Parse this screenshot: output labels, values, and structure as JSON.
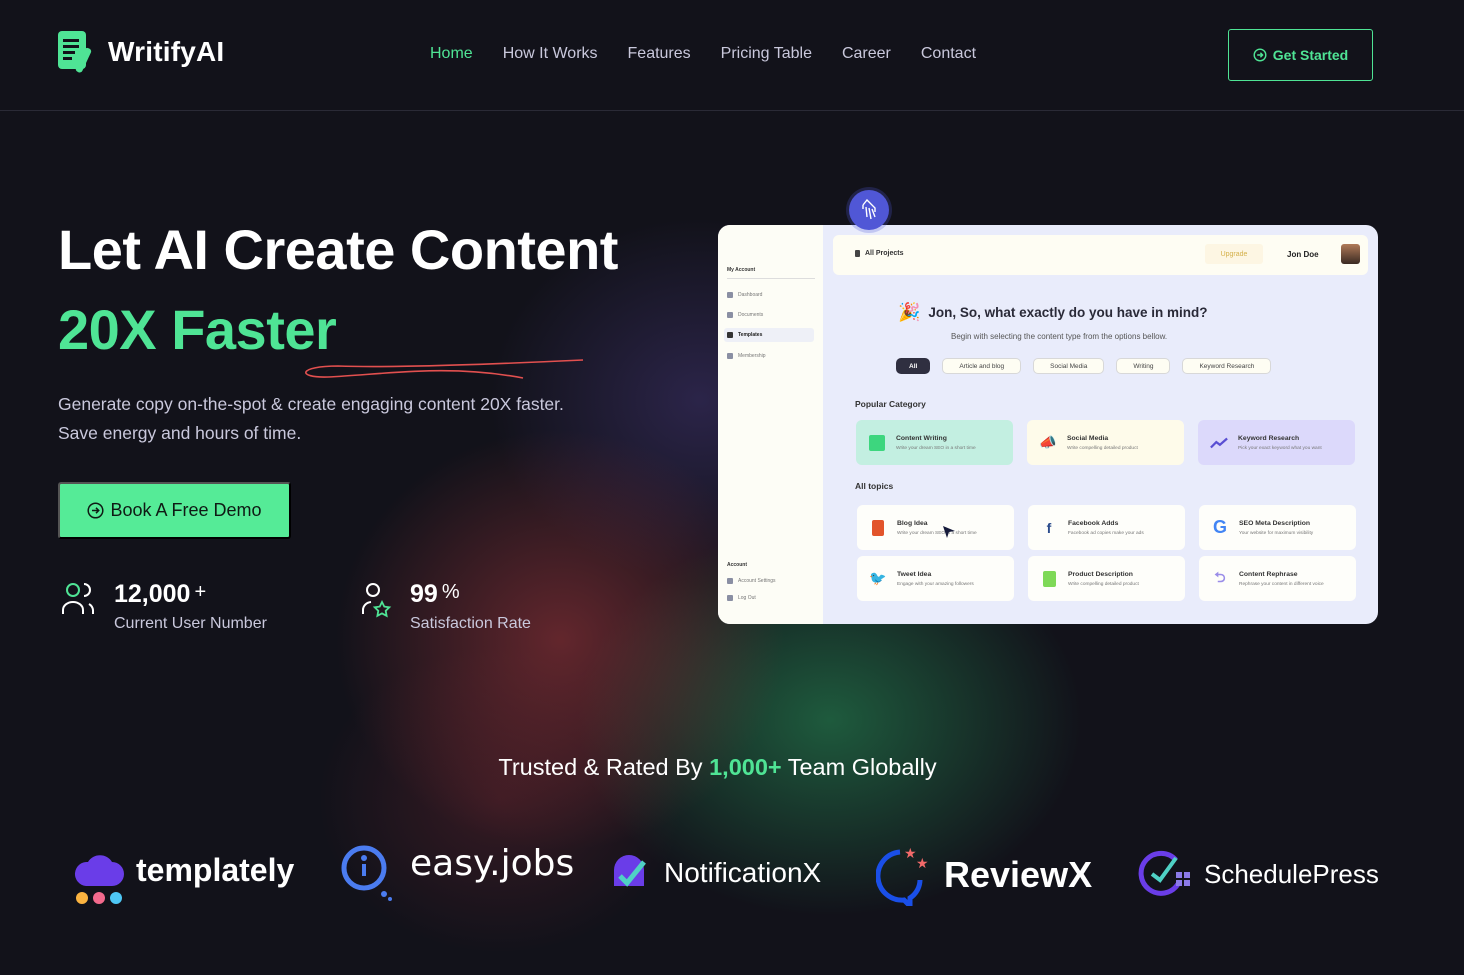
{
  "header": {
    "brand": "WritifyAI",
    "nav": [
      {
        "label": "Home",
        "active": true
      },
      {
        "label": "How It Works",
        "active": false
      },
      {
        "label": "Features",
        "active": false
      },
      {
        "label": "Pricing Table",
        "active": false
      },
      {
        "label": "Career",
        "active": false
      },
      {
        "label": "Contact",
        "active": false
      }
    ],
    "cta_label": "Get Started"
  },
  "hero": {
    "title_line1": "Let AI Create Content",
    "title_line2": "20X Faster",
    "desc_line1": "Generate copy on-the-spot & create engaging content 20X faster.",
    "desc_line2": "Save energy and hours of time.",
    "demo_label": "Book A Free Demo",
    "stats": [
      {
        "value": "12,000",
        "suffix": "+",
        "label": "Current User Number",
        "icon": "users-icon"
      },
      {
        "value": "99",
        "suffix": "%",
        "label": "Satisfaction Rate",
        "icon": "user-star-icon"
      }
    ]
  },
  "mockup": {
    "sidebar": {
      "section_title": "My Account",
      "items": [
        {
          "label": "Dashboard",
          "active": false
        },
        {
          "label": "Documents",
          "active": false
        },
        {
          "label": "Templates",
          "active": true
        },
        {
          "label": "Membership",
          "active": false
        }
      ],
      "account_title": "Account",
      "account_items": [
        {
          "label": "Account Settings"
        },
        {
          "label": "Log Out"
        }
      ]
    },
    "topbar": {
      "projects_label": "All Projects",
      "upgrade_label": "Upgrade",
      "user_name": "Jon Doe"
    },
    "question": "Jon, So, what exactly do you have in mind?",
    "subtitle": "Begin with selecting the content type from the options bellow.",
    "chips": [
      {
        "label": "All",
        "active": true
      },
      {
        "label": "Article and blog",
        "active": false
      },
      {
        "label": "Social Media",
        "active": false
      },
      {
        "label": "Writing",
        "active": false
      },
      {
        "label": "Keyword Research",
        "active": false
      }
    ],
    "popular_title": "Popular Category",
    "popular": [
      {
        "title": "Content Writing",
        "desc": "Write your dream SEO in a short time",
        "color": "#c3efe1"
      },
      {
        "title": "Social Media",
        "desc": "Write compelling detailed product",
        "color": "#fefbea"
      },
      {
        "title": "Keyword Research",
        "desc": "Pick your exact keyword what you want",
        "color": "#dcd9fb"
      }
    ],
    "topics_title": "All topics",
    "topics": [
      {
        "title": "Blog Idea",
        "desc": "Write your dream SEO in a short time"
      },
      {
        "title": "Facebook Adds",
        "desc": "Facebook ad copies make your ads"
      },
      {
        "title": "SEO Meta Description",
        "desc": "Your website for maximum visibility"
      },
      {
        "title": "Tweet Idea",
        "desc": "Engage with your amazing followers"
      },
      {
        "title": "Product Description",
        "desc": "Write compelling detailed product"
      },
      {
        "title": "Content Rephrase",
        "desc": "Rephrase your content in different voice"
      }
    ]
  },
  "trusted": {
    "prefix": "Trusted & Rated By ",
    "highlight": "1,000+",
    "suffix": " Team Globally"
  },
  "brands": [
    "templately",
    "easy.jobs",
    "NotificationX",
    "ReviewX",
    "SchedulePress"
  ],
  "colors": {
    "accent": "#4fe495",
    "background": "#12121a",
    "button": "#55eb97"
  }
}
